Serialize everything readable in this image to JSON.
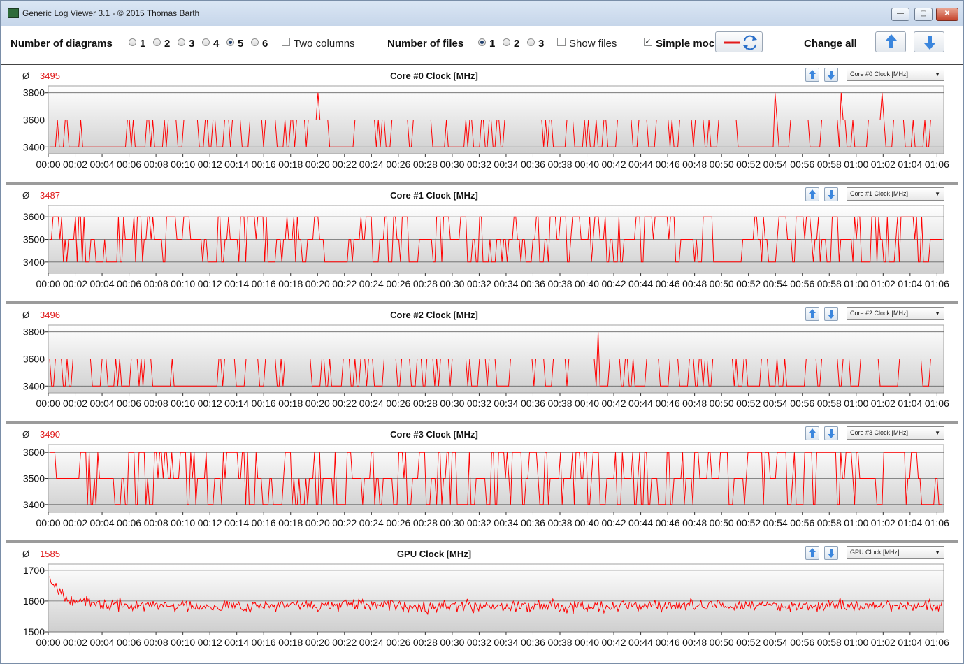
{
  "window": {
    "title": "Generic Log Viewer 3.1 - © 2015 Thomas Barth",
    "controls": {
      "minimize": "—",
      "maximize": "▢",
      "close": "✕"
    }
  },
  "toolbar": {
    "num_diagrams_label": "Number of diagrams",
    "diagram_options": [
      "1",
      "2",
      "3",
      "4",
      "5",
      "6"
    ],
    "diagram_selected": "5",
    "two_columns_label": "Two columns",
    "two_columns_checked": false,
    "num_files_label": "Number of files",
    "file_options": [
      "1",
      "2",
      "3"
    ],
    "file_selected": "1",
    "show_files_label": "Show files",
    "show_files_checked": false,
    "simple_mode_label": "Simple moc",
    "simple_mode_checked": true,
    "change_all_label": "Change all",
    "icons": {
      "line_color": "red-line-icon",
      "swap": "swap-arrows-icon",
      "up": "arrow-up-icon",
      "down": "arrow-down-icon"
    }
  },
  "colors": {
    "series": "#ff0000",
    "avg_text": "#e01b1b",
    "band_dark": "#cfcfcf",
    "band_light": "#ffffff"
  },
  "x_ticks": [
    "00:00",
    "00:02",
    "00:04",
    "00:06",
    "00:08",
    "00:10",
    "00:12",
    "00:14",
    "00:16",
    "00:18",
    "00:20",
    "00:22",
    "00:24",
    "00:26",
    "00:28",
    "00:30",
    "00:32",
    "00:34",
    "00:36",
    "00:38",
    "00:40",
    "00:42",
    "00:44",
    "00:46",
    "00:48",
    "00:50",
    "00:52",
    "00:54",
    "00:56",
    "00:58",
    "01:00",
    "01:02",
    "01:04",
    "01:06"
  ],
  "panels": [
    {
      "title": "Core #0 Clock [MHz]",
      "avg_symbol": "Ø",
      "avg": "3495",
      "select": "Core #0 Clock [MHz]"
    },
    {
      "title": "Core #1 Clock [MHz]",
      "avg_symbol": "Ø",
      "avg": "3487",
      "select": "Core #1 Clock [MHz]"
    },
    {
      "title": "Core #2 Clock [MHz]",
      "avg_symbol": "Ø",
      "avg": "3496",
      "select": "Core #2 Clock [MHz]"
    },
    {
      "title": "Core #3 Clock [MHz]",
      "avg_symbol": "Ø",
      "avg": "3490",
      "select": "Core #3 Clock [MHz]"
    },
    {
      "title": "GPU Clock [MHz]",
      "avg_symbol": "Ø",
      "avg": "1585",
      "select": "GPU Clock [MHz]"
    }
  ],
  "chart_data": [
    {
      "type": "line",
      "title": "Core #0 Clock [MHz]",
      "x_range": [
        "00:00",
        "01:06"
      ],
      "ylim": [
        3350,
        3850
      ],
      "y_ticks": [
        3400,
        3600,
        3800
      ],
      "points": 460,
      "levels": [
        3400,
        3600
      ],
      "spikes_to": 3800,
      "spike_times_min": [
        20.0,
        54.0,
        59.0,
        62.0
      ],
      "average": 3495,
      "seed": 11
    },
    {
      "type": "line",
      "title": "Core #1 Clock [MHz]",
      "x_range": [
        "00:00",
        "01:06"
      ],
      "ylim": [
        3350,
        3650
      ],
      "y_ticks": [
        3400,
        3500,
        3600
      ],
      "points": 520,
      "levels": [
        3400,
        3500,
        3600
      ],
      "spike_times_min": [],
      "average": 3487,
      "seed": 23
    },
    {
      "type": "line",
      "title": "Core #2 Clock [MHz]",
      "x_range": [
        "00:00",
        "01:06"
      ],
      "ylim": [
        3350,
        3850
      ],
      "y_ticks": [
        3400,
        3600,
        3800
      ],
      "points": 460,
      "levels": [
        3400,
        3600
      ],
      "spikes_to": 3800,
      "spike_times_min": [
        40.8
      ],
      "average": 3496,
      "seed": 37
    },
    {
      "type": "line",
      "title": "Core #3 Clock [MHz]",
      "x_range": [
        "00:00",
        "01:06"
      ],
      "ylim": [
        3370,
        3630
      ],
      "y_ticks": [
        3400,
        3500,
        3600
      ],
      "points": 520,
      "levels": [
        3400,
        3500,
        3600
      ],
      "spike_times_min": [],
      "average": 3490,
      "seed": 51
    },
    {
      "type": "line",
      "title": "GPU Clock [MHz]",
      "x_range": [
        "00:00",
        "01:06"
      ],
      "ylim": [
        1500,
        1720
      ],
      "y_ticks": [
        1500,
        1600,
        1700
      ],
      "points": 700,
      "start_value": 1680,
      "mean": 1585,
      "noise": 14,
      "average": 1585,
      "seed": 67
    }
  ]
}
